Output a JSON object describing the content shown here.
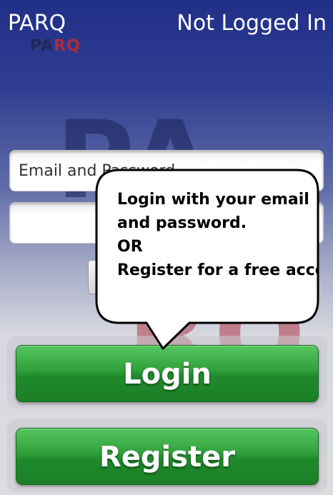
{
  "header": {
    "app_title": "PARQ",
    "login_status": "Not Logged In"
  },
  "logo": {
    "part1": "PA",
    "part2": "RQ"
  },
  "watermark": {
    "top": "PA",
    "bottom": "RQ"
  },
  "form": {
    "email_placeholder": "Email and Password",
    "password_value": ""
  },
  "tooltip": {
    "line1": "Login with your email",
    "line2": "and password.",
    "line3": "OR",
    "line4": "Register for a free account"
  },
  "buttons": {
    "login_label": "Login",
    "register_label": "Register"
  },
  "colors": {
    "header_bg": "#1f2e86",
    "button_green": "#2f9f3a",
    "logo_red": "#b02a3a"
  }
}
